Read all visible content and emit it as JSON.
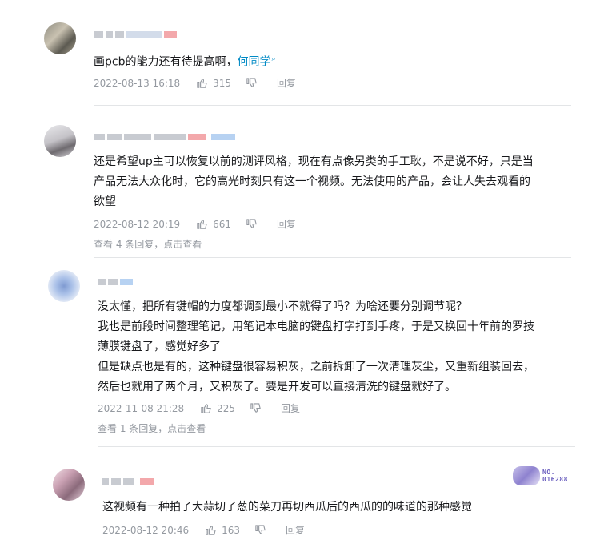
{
  "comments": [
    {
      "text": "画pcb的能力还有待提高啊，",
      "mention": "何同学",
      "time": "2022-08-13 16:18",
      "likes": "315",
      "reply_label": "回复"
    },
    {
      "lines": [
        "还是希望up主可以恢复以前的测评风格，现在有点像另类的手工耿，不是说不好，只是当",
        "产品无法大众化时，它的高光时刻只有这一个视频。无法使用的产品，会让人失去观看的",
        "欲望"
      ],
      "time": "2022-08-12 20:19",
      "likes": "661",
      "reply_label": "回复",
      "sub_replies": "查看 4 条回复，点击查看"
    },
    {
      "lines": [
        "没太懂，把所有键帽的力度都调到最小不就得了吗？为啥还要分别调节呢？",
        "我也是前段时间整理笔记，用笔记本电脑的键盘打字打到手疼，于是又换回十年前的罗技",
        "薄膜键盘了，感觉好多了",
        "但是缺点也是有的，这种键盘很容易积灰，之前拆卸了一次清理灰尘，又重新组装回去，",
        "然后也就用了两个月，又积灰了。要是开发可以直接清洗的键盘就好了。"
      ],
      "time": "2022-11-08 21:28",
      "likes": "225",
      "reply_label": "回复",
      "sub_replies": "查看 1 条回复，点击查看"
    },
    {
      "text": "这视频有一种拍了大蒜切了葱的菜刀再切西瓜后的西瓜的的味道的那种感觉",
      "time": "2022-08-12 20:46",
      "likes": "163",
      "reply_label": "回复",
      "badge": {
        "line1": "NO.",
        "line2": "016288"
      }
    }
  ],
  "icons": {
    "like": "thumbs-up-icon",
    "dislike": "thumbs-down-icon",
    "mention": "search-icon"
  },
  "colors": {
    "link": "#008ac5",
    "meta": "#9499a0",
    "text": "#18191c"
  }
}
